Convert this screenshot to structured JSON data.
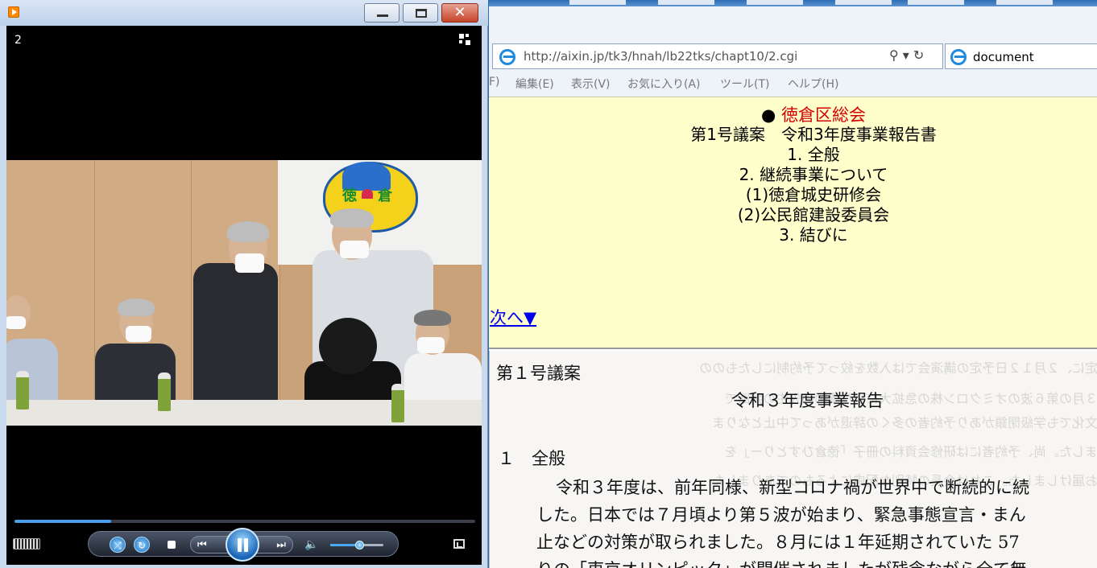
{
  "player": {
    "counter": "2",
    "progress_fraction": 0.21,
    "volume_fraction": 0.55,
    "buttons": [
      "minimize-button",
      "maximize-button",
      "close-button"
    ]
  },
  "browser": {
    "address": "http://aixin.jp/tk3/hnah/lb22tks/chapt10/2.cgi",
    "address_actions": "⚲ ▾ ↻",
    "tab_title": "document",
    "menu": [
      "F)",
      "編集(E)",
      "表示(V)",
      "お気に入り(A)",
      "ツール(T)",
      "ヘルプ(H)"
    ]
  },
  "top_frame": {
    "bullet": "●",
    "title": "徳倉区総会",
    "lines": [
      "第1号議案　令和3年度事業報告書",
      "1. 全般",
      "2. 継続事業について",
      "(1)徳倉城史研修会",
      "(2)公民館建設委員会",
      "3. 結びに"
    ],
    "next_link": "次へ▼"
  },
  "document": {
    "heading": "第１号議案",
    "subtitle": "令和３年度事業報告",
    "section": "１　全般",
    "para1": "令和３年度は、前年同様、新型コロナ禍が世界中で断続的に続",
    "para2": "した。日本では７月頃より第５波が始まり、緊急事態宣言・まん",
    "para3": "止などの対策が取られました。８月には１年延期されていた 57",
    "para4": "りの「東京オリンピック」が開催されましたが残念ながら全て無"
  }
}
